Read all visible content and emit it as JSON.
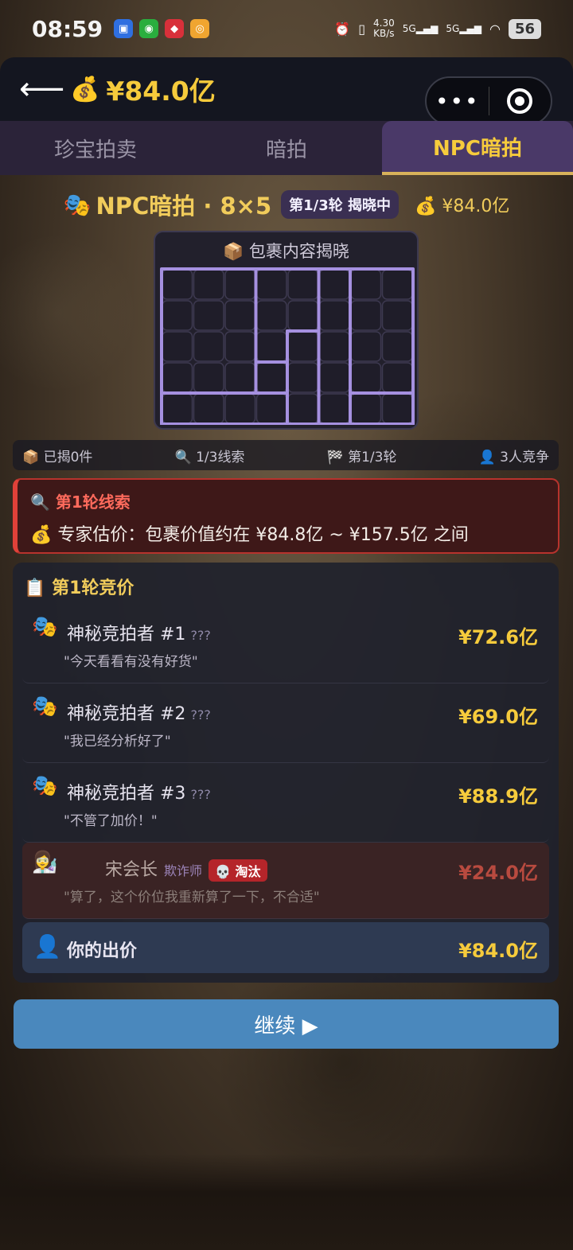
{
  "status_bar": {
    "time": "08:59",
    "net_speed_value": "4.30",
    "net_speed_unit": "KB/s",
    "signal1": "5G",
    "signal2": "5G",
    "battery": "56"
  },
  "header": {
    "balance": "¥84.0亿"
  },
  "tabs": [
    {
      "label": "珍宝拍卖",
      "active": false
    },
    {
      "label": "暗拍",
      "active": false
    },
    {
      "label": "NPC暗拍",
      "active": true
    }
  ],
  "game": {
    "title": "NPC暗拍 · 8×5",
    "round_badge": "第1/3轮 揭晓中",
    "money": "¥84.0亿"
  },
  "grid_panel": {
    "title": "包裹内容揭晓"
  },
  "stats": {
    "revealed": "已揭0件",
    "clues": "1/3线索",
    "round": "第1/3轮",
    "competitors": "3人竞争"
  },
  "clue": {
    "title": "第1轮线索",
    "text": "专家估价：包裹价值约在 ¥84.8亿 ~ ¥157.5亿 之间"
  },
  "bids": {
    "header": "第1轮竞价",
    "rows": [
      {
        "name": "神秘竞拍者 #1",
        "tag": "???",
        "quote": "\"今天看看有没有好货\"",
        "amount": "¥72.6亿"
      },
      {
        "name": "神秘竞拍者 #2",
        "tag": "???",
        "quote": "\"我已经分析好了\"",
        "amount": "¥69.0亿"
      },
      {
        "name": "神秘竞拍者 #3",
        "tag": "???",
        "quote": "\"不管了加价！\"",
        "amount": "¥88.9亿"
      },
      {
        "name": "宋会长",
        "role": "欺诈师",
        "badge": "淘汰",
        "quote": "\"算了，这个价位我重新算了一下，不合适\"",
        "amount": "¥24.0亿"
      }
    ],
    "your_bid": {
      "label": "你的出价",
      "amount": "¥84.0亿"
    }
  },
  "continue_label": "继续 ▶",
  "colors": {
    "accent_gold": "#f6cb3c",
    "tab_active_bg": "#4a3968",
    "clue_red": "#e04139",
    "button_blue": "#4a88bd",
    "grid_line": "#a590e0"
  }
}
